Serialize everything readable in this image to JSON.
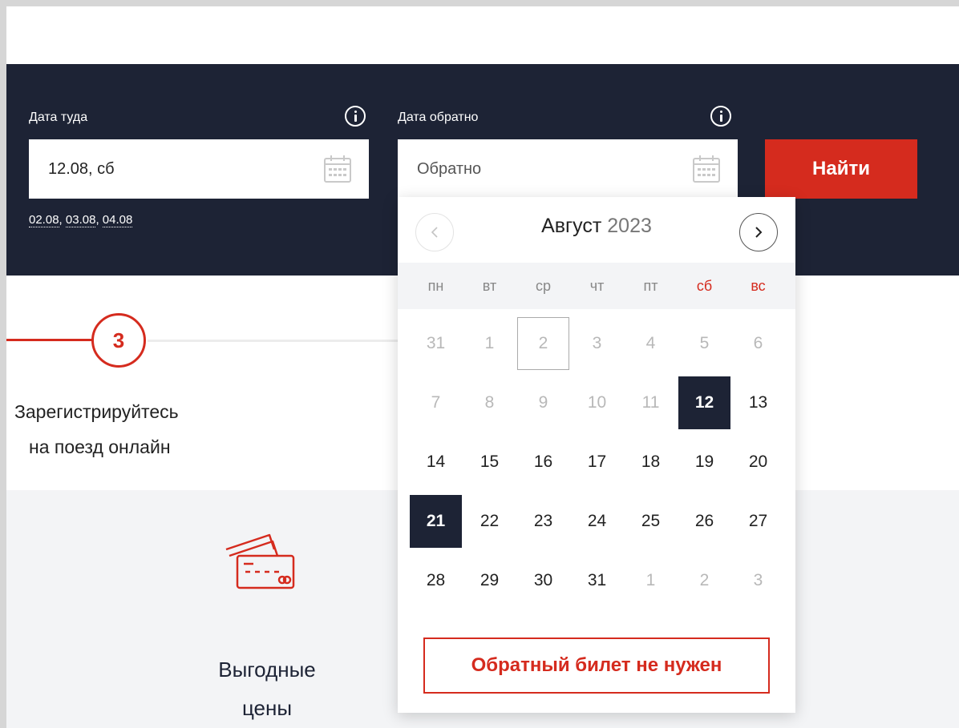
{
  "search": {
    "depart": {
      "label": "Дата туда",
      "value": "12.08, сб",
      "quick_dates": [
        "02.08",
        "03.08",
        "04.08"
      ]
    },
    "return": {
      "label": "Дата обратно",
      "placeholder": "Обратно"
    },
    "find_button": "Найти"
  },
  "step": {
    "number": "3",
    "line1": "Зарегистрируйтесь",
    "line2": "на поезд онлайн"
  },
  "feature": {
    "line1": "Выгодные",
    "line2": "цены"
  },
  "calendar": {
    "month": "Август",
    "year": "2023",
    "weekdays": [
      {
        "label": "пн",
        "weekend": false
      },
      {
        "label": "вт",
        "weekend": false
      },
      {
        "label": "ср",
        "weekend": false
      },
      {
        "label": "чт",
        "weekend": false
      },
      {
        "label": "пт",
        "weekend": false
      },
      {
        "label": "сб",
        "weekend": true
      },
      {
        "label": "вс",
        "weekend": true
      }
    ],
    "days": [
      {
        "d": "31",
        "state": "muted"
      },
      {
        "d": "1",
        "state": "muted"
      },
      {
        "d": "2",
        "state": "today"
      },
      {
        "d": "3",
        "state": "muted"
      },
      {
        "d": "4",
        "state": "muted"
      },
      {
        "d": "5",
        "state": "muted"
      },
      {
        "d": "6",
        "state": "muted"
      },
      {
        "d": "7",
        "state": "muted"
      },
      {
        "d": "8",
        "state": "muted"
      },
      {
        "d": "9",
        "state": "muted"
      },
      {
        "d": "10",
        "state": "muted"
      },
      {
        "d": "11",
        "state": "muted"
      },
      {
        "d": "12",
        "state": "selected"
      },
      {
        "d": "13",
        "state": "normal"
      },
      {
        "d": "14",
        "state": "normal"
      },
      {
        "d": "15",
        "state": "normal"
      },
      {
        "d": "16",
        "state": "normal"
      },
      {
        "d": "17",
        "state": "normal"
      },
      {
        "d": "18",
        "state": "normal"
      },
      {
        "d": "19",
        "state": "normal"
      },
      {
        "d": "20",
        "state": "normal"
      },
      {
        "d": "21",
        "state": "selected"
      },
      {
        "d": "22",
        "state": "normal"
      },
      {
        "d": "23",
        "state": "normal"
      },
      {
        "d": "24",
        "state": "normal"
      },
      {
        "d": "25",
        "state": "normal"
      },
      {
        "d": "26",
        "state": "normal"
      },
      {
        "d": "27",
        "state": "normal"
      },
      {
        "d": "28",
        "state": "normal"
      },
      {
        "d": "29",
        "state": "normal"
      },
      {
        "d": "30",
        "state": "normal"
      },
      {
        "d": "31",
        "state": "normal"
      },
      {
        "d": "1",
        "state": "muted"
      },
      {
        "d": "2",
        "state": "muted"
      },
      {
        "d": "3",
        "state": "muted"
      }
    ],
    "no_return_button": "Обратный билет не нужен"
  },
  "colors": {
    "panel": "#1d2335",
    "accent": "#d52b1e"
  },
  "icons": {
    "info": "info-icon",
    "calendar": "calendar-icon",
    "prev": "chevron-left-icon",
    "next": "chevron-right-icon",
    "cards": "credit-cards-icon"
  }
}
